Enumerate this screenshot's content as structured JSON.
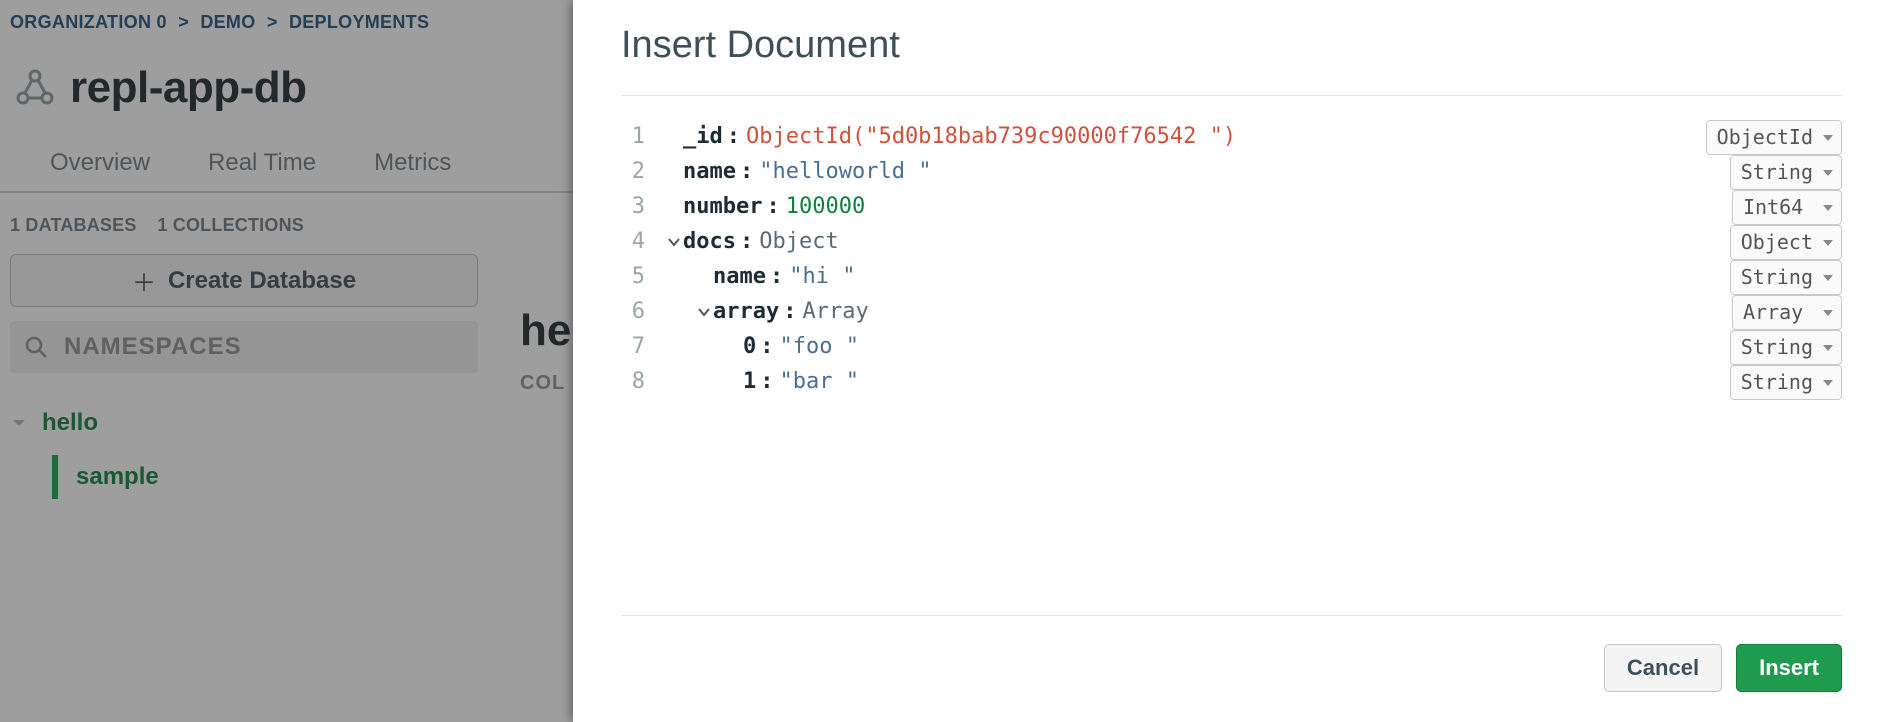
{
  "breadcrumb": {
    "org": "ORGANIZATION 0",
    "project": "DEMO",
    "section": "DEPLOYMENTS"
  },
  "cluster": {
    "name": "repl-app-db"
  },
  "tabs": {
    "overview": "Overview",
    "realtime": "Real Time",
    "metrics": "Metrics"
  },
  "stats": {
    "databases": "1 DATABASES",
    "collections": "1 COLLECTIONS"
  },
  "sidebar": {
    "createDatabase": "Create Database",
    "namespacesPlaceholder": "NAMESPACES",
    "tree": {
      "db": "hello",
      "collection": "sample"
    }
  },
  "rightPreview": {
    "heading": "he",
    "sub": "COL"
  },
  "modal": {
    "title": "Insert Document",
    "rows": [
      {
        "line": "1",
        "indent": 0,
        "toggle": false,
        "field": "_id",
        "valueKind": "oid",
        "value": "ObjectId(\"5d0b18bab739c90000f76542 \")",
        "type": "ObjectId"
      },
      {
        "line": "2",
        "indent": 0,
        "toggle": false,
        "field": "name",
        "valueKind": "str",
        "value": "helloworld ",
        "type": "String"
      },
      {
        "line": "3",
        "indent": 0,
        "toggle": false,
        "field": "number",
        "valueKind": "num",
        "value": "100000",
        "type": "Int64"
      },
      {
        "line": "4",
        "indent": 0,
        "toggle": true,
        "field": "docs",
        "valueKind": "type",
        "value": "Object",
        "type": "Object"
      },
      {
        "line": "5",
        "indent": 1,
        "toggle": false,
        "field": "name",
        "valueKind": "str",
        "value": "hi ",
        "type": "String"
      },
      {
        "line": "6",
        "indent": 1,
        "toggle": true,
        "field": "array",
        "valueKind": "type",
        "value": "Array",
        "type": "Array"
      },
      {
        "line": "7",
        "indent": 2,
        "toggle": false,
        "field": "0",
        "valueKind": "str",
        "value": "foo ",
        "type": "String"
      },
      {
        "line": "8",
        "indent": 2,
        "toggle": false,
        "field": "1",
        "valueKind": "str",
        "value": "bar ",
        "type": "String"
      }
    ],
    "buttons": {
      "cancel": "Cancel",
      "insert": "Insert"
    }
  }
}
